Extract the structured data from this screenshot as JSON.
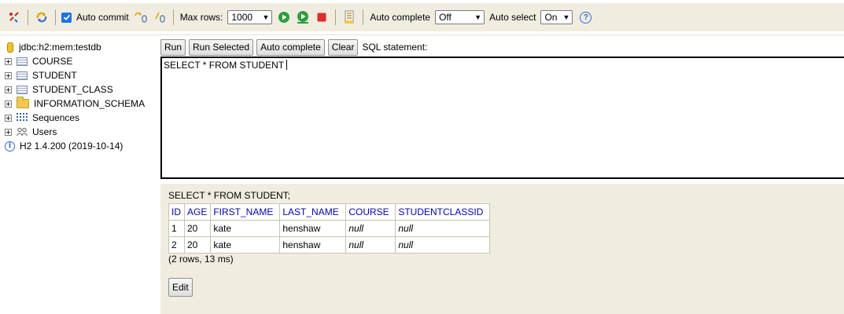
{
  "toolbar": {
    "auto_commit_label": "Auto commit",
    "max_rows_label": "Max rows:",
    "max_rows_value": "1000",
    "auto_complete_label": "Auto complete",
    "auto_complete_value": "Off",
    "auto_select_label": "Auto select",
    "auto_select_value": "On",
    "help_glyph": "?"
  },
  "tree": {
    "connection": "jdbc:h2:mem:testdb",
    "items": [
      {
        "label": "COURSE",
        "icon": "table-icon"
      },
      {
        "label": "STUDENT",
        "icon": "table-icon"
      },
      {
        "label": "STUDENT_CLASS",
        "icon": "table-icon"
      },
      {
        "label": "INFORMATION_SCHEMA",
        "icon": "folder-icon"
      },
      {
        "label": "Sequences",
        "icon": "sequences-icon"
      },
      {
        "label": "Users",
        "icon": "users-icon"
      }
    ],
    "version": "H2 1.4.200 (2019-10-14)"
  },
  "buttons": {
    "run": "Run",
    "run_selected": "Run Selected",
    "auto_complete": "Auto complete",
    "clear": "Clear",
    "sql_statement_label": "SQL statement:"
  },
  "editor": {
    "text": "SELECT * FROM STUDENT"
  },
  "result": {
    "statement": "SELECT * FROM STUDENT;",
    "columns": [
      "ID",
      "AGE",
      "FIRST_NAME",
      "LAST_NAME",
      "COURSE",
      "STUDENTCLASSID"
    ],
    "rows": [
      [
        "1",
        "20",
        "kate",
        "henshaw",
        "null",
        "null"
      ],
      [
        "2",
        "20",
        "kate",
        "henshaw",
        "null",
        "null"
      ]
    ],
    "summary": "(2 rows, 13 ms)",
    "edit_label": "Edit"
  }
}
